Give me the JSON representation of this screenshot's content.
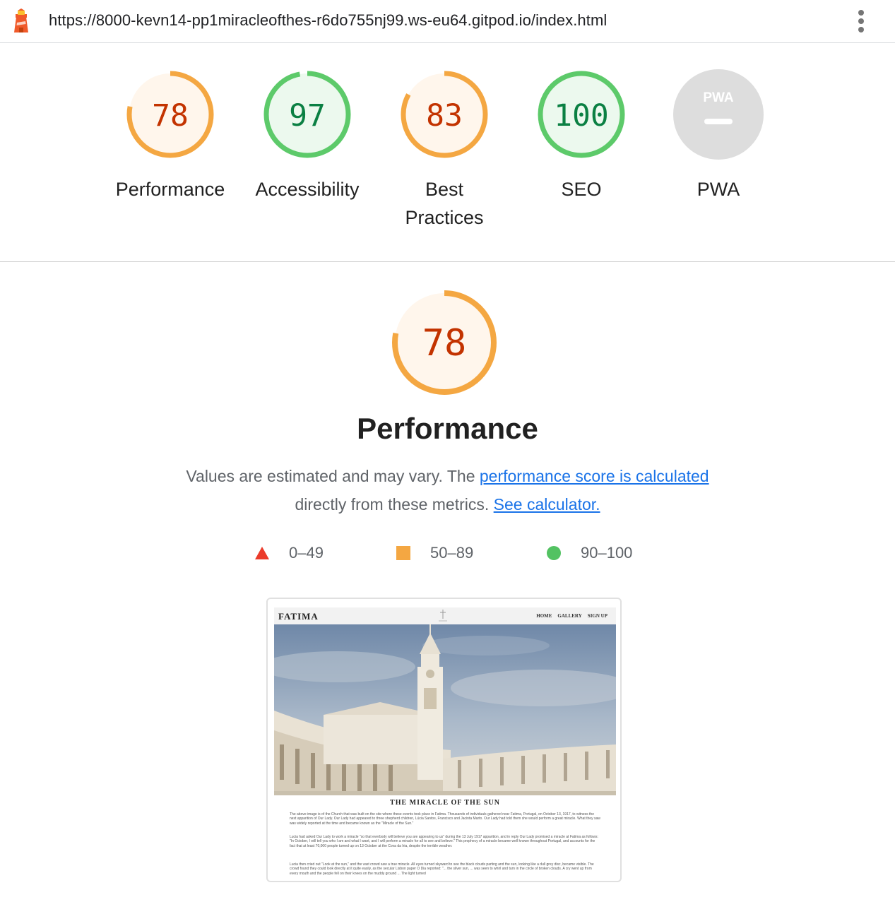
{
  "browser": {
    "url": "https://8000-kevn14-pp1miracleofthes-r6do755nj99.ws-eu64.gitpod.io/index.html"
  },
  "gauges": [
    {
      "label": "Performance",
      "score": "78",
      "level": 0.78,
      "status": "average"
    },
    {
      "label": "Accessibility",
      "score": "97",
      "level": 0.97,
      "status": "pass"
    },
    {
      "label": "Best Practices",
      "score": "83",
      "level": 0.83,
      "status": "average"
    },
    {
      "label": "SEO",
      "score": "100",
      "level": 1.0,
      "status": "pass"
    },
    {
      "label": "PWA",
      "score": "",
      "badge": "PWA",
      "status": "na"
    }
  ],
  "category": {
    "score": "78",
    "level": 0.78,
    "title": "Performance",
    "desc_prefix": "Values are estimated and may vary. The ",
    "desc_link": "performance score is calculated",
    "desc_middle": "directly from these metrics. ",
    "desc_link2": "See calculator."
  },
  "legend": [
    {
      "range": "0–49",
      "shape": "triangle",
      "color": "#eb3b2a"
    },
    {
      "range": "50–89",
      "shape": "square",
      "color": "#f4a742"
    },
    {
      "range": "90–100",
      "shape": "circle",
      "color": "#53c262"
    }
  ],
  "colors": {
    "fail": "#c33300",
    "average": "#c33300",
    "average_arc": "#f4a742",
    "average_bg": "#fff6ec",
    "pass": "#0b8043",
    "pass_arc": "#5dca6a",
    "pass_bg": "#ecf9ee",
    "na": "#dddddd",
    "link": "#1a73e8"
  },
  "thumbnail": {
    "brand": "FATIMA",
    "nav": [
      "HOME",
      "GALLERY",
      "SIGN UP"
    ],
    "heading": "THE MIRACLE OF THE SUN",
    "p1": "The above image is of the Church that was built on the site where these events took place in Fatima. Thousands of individuals gathered near Fatima, Portugal, on October 13, 1917, to witness the next apparition of Our Lady. Our Lady had appeared to three shepherd children, Lúcia Santos, Francisco and Jacinta Marto. Our Lady had told them she would perform a great miracle. What they saw was widely reported at the time and became known as the \"Miracle of the Sun.\"",
    "p2": "Lucia had asked Our Lady to work a miracle \"so that everbody will believe you are appearing to us\" during the 13 July 1917 apparition, and in reply Our Lady promised a miracle at Fatima as follows: \"In October, I will tell you who I am and what I want, and I will perform a miracle for all to see and believe.\" This prophecy of a miracle became well known throughout Portugal, and accounts for the fact that at least 70,000 people turned up on 13 October at the Cova da Iria, despite the terrible weather.",
    "p3": "Lucia then cried out \"Look at the sun,\" and the vast crowd saw a true miracle. All eyes turned skyward to see the black clouds parting and the sun, looking like a dull grey disc, became visible. The crowd found they could look directly at it quite easily, as the secular Lisbon paper O Dia reported: \"... the silver sun, ... was seen to whirl and turn in the circle of broken clouds. A cry went up from every mouth and the people fell on their knees on the muddy ground ... The light turned"
  }
}
